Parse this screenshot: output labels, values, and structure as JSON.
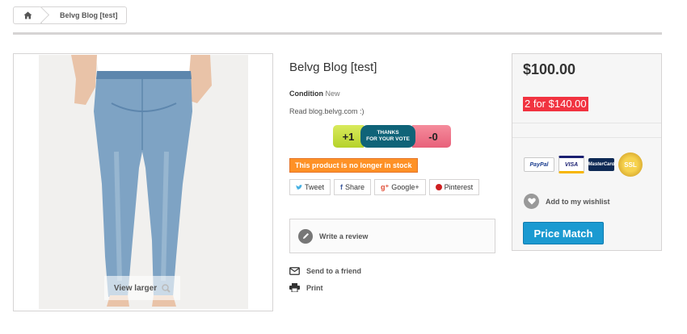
{
  "breadcrumb": {
    "home_icon": "home-icon",
    "current": "Belvg Blog [test]"
  },
  "product": {
    "title": "Belvg Blog [test]",
    "condition_label": "Condition",
    "condition_value": "New",
    "short_description": "Read blog.belvg.com :)",
    "view_larger": "View larger",
    "stock_message": "This product is no longer in stock"
  },
  "vote": {
    "plus": "+1",
    "thanks_line1": "THANKS",
    "thanks_line2": "FOR YOUR VOTE",
    "minus": "-0"
  },
  "share": {
    "tweet": "Tweet",
    "share": "Share",
    "google": "Google+",
    "pinterest": "Pinterest"
  },
  "actions": {
    "write_review": "Write a review",
    "send_friend": "Send to a friend",
    "print": "Print"
  },
  "buy": {
    "price": "$100.00",
    "promo": "2 for $140.00",
    "logos": {
      "paypal": "PayPal",
      "visa": "VISA",
      "mastercard": "MasterCard",
      "ssl": "SSL"
    },
    "wishlist": "Add to my wishlist",
    "price_match": "Price Match"
  },
  "colors": {
    "stock_badge": "#fe9126",
    "promo": "#f13340",
    "price_match": "#1b9ad1",
    "vote_mid": "#0f6378"
  }
}
